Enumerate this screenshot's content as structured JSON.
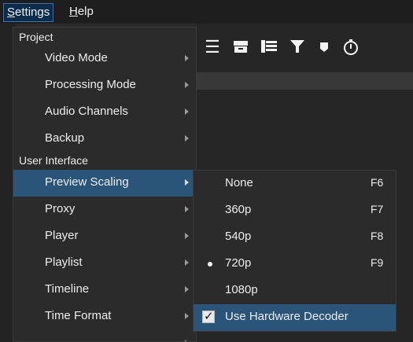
{
  "menubar": {
    "settings": "Settings",
    "help": "Help"
  },
  "toolbar": {
    "icons": [
      "list-icon",
      "archive-icon",
      "timeline-list-icon",
      "filter-icon",
      "marker-icon",
      "timer-icon"
    ]
  },
  "settings_menu": {
    "project_header": "Project",
    "items_project": [
      {
        "label": "Video Mode"
      },
      {
        "label": "Processing Mode"
      },
      {
        "label": "Audio Channels"
      },
      {
        "label": "Backup"
      }
    ],
    "ui_header": "User Interface",
    "items_ui": [
      {
        "label": "Preview Scaling",
        "active": true
      },
      {
        "label": "Proxy"
      },
      {
        "label": "Player"
      },
      {
        "label": "Playlist"
      },
      {
        "label": "Timeline"
      },
      {
        "label": "Time Format"
      }
    ]
  },
  "preview_scaling_menu": {
    "items": [
      {
        "label": "None",
        "shortcut": "F6"
      },
      {
        "label": "360p",
        "shortcut": "F7"
      },
      {
        "label": "540p",
        "shortcut": "F8"
      },
      {
        "label": "720p",
        "shortcut": "F9",
        "selected": true
      },
      {
        "label": "1080p",
        "shortcut": ""
      },
      {
        "label": "Use Hardware Decoder",
        "shortcut": "",
        "checked": true
      }
    ]
  }
}
